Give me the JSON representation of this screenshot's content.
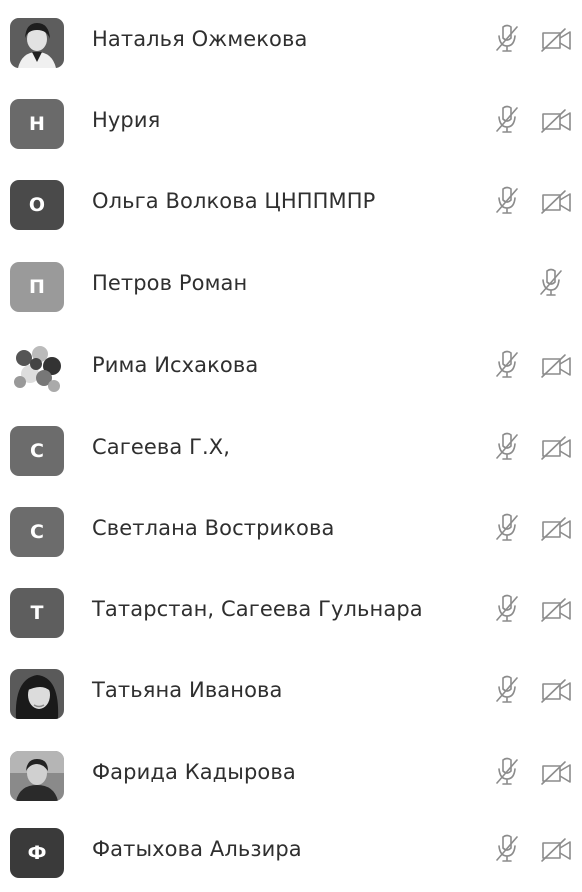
{
  "participants": [
    {
      "name": "Наталья Ожмекова",
      "avatar_type": "photo",
      "avatar_letter": "",
      "avatar_color": "#555555",
      "mic_icon": "mic-muted-icon",
      "video_icon": "video-off-icon"
    },
    {
      "name": "Нурия",
      "avatar_type": "letter",
      "avatar_letter": "Н",
      "avatar_color": "#6a6a6a",
      "mic_icon": "mic-muted-icon",
      "video_icon": "video-off-icon"
    },
    {
      "name": "Ольга Волкова ЦНППМПР",
      "avatar_type": "letter",
      "avatar_letter": "О",
      "avatar_color": "#4a4a4a",
      "mic_icon": "mic-muted-icon",
      "video_icon": "video-off-icon"
    },
    {
      "name": "Петров Роман",
      "avatar_type": "letter",
      "avatar_letter": "П",
      "avatar_color": "#9a9a9a",
      "mic_icon": "mic-muted-icon",
      "video_icon": ""
    },
    {
      "name": "Рима Исхакова",
      "avatar_type": "photo",
      "avatar_letter": "",
      "avatar_color": "#666666",
      "mic_icon": "mic-muted-icon",
      "video_icon": "video-off-icon"
    },
    {
      "name": "Сагеева Г.Х,",
      "avatar_type": "letter",
      "avatar_letter": "С",
      "avatar_color": "#6c6c6c",
      "mic_icon": "mic-muted-icon",
      "video_icon": "video-off-icon"
    },
    {
      "name": "Светлана Вострикова",
      "avatar_type": "letter",
      "avatar_letter": "С",
      "avatar_color": "#6c6c6c",
      "mic_icon": "mic-muted-icon",
      "video_icon": "video-off-icon"
    },
    {
      "name": "Татарстан, Сагеева Гульнара",
      "avatar_type": "letter",
      "avatar_letter": "Т",
      "avatar_color": "#5e5e5e",
      "mic_icon": "mic-muted-icon",
      "video_icon": "video-off-icon"
    },
    {
      "name": "Татьяна Иванова",
      "avatar_type": "photo",
      "avatar_letter": "",
      "avatar_color": "#333333",
      "mic_icon": "mic-muted-icon",
      "video_icon": "video-off-icon"
    },
    {
      "name": "Фарида Кадырова",
      "avatar_type": "photo",
      "avatar_letter": "",
      "avatar_color": "#4d4d4d",
      "mic_icon": "mic-muted-icon",
      "video_icon": "video-off-icon"
    },
    {
      "name": "Фатыхова Альзира",
      "avatar_type": "letter",
      "avatar_letter": "Ф",
      "avatar_color": "#3a3a3a",
      "mic_icon": "mic-muted-icon",
      "video_icon": "video-off-icon"
    }
  ]
}
